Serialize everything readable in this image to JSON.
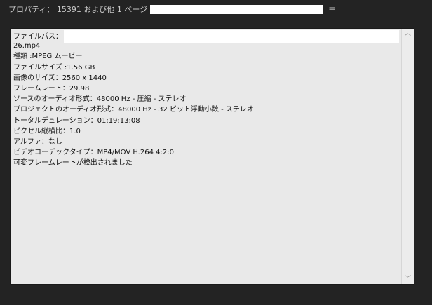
{
  "header": {
    "title": "プロパティ： 15391 および他 1 ページ",
    "menu_icon": "menu-icon",
    "menu_glyph": "≡"
  },
  "properties": {
    "file_path_label": "ファイルパス：",
    "lines": [
      "26.mp4",
      "種類 :MPEG ムービー",
      "ファイルサイズ :1.56 GB",
      "画像のサイズ：2560 x 1440",
      "フレームレート：29.98",
      "ソースのオーディオ形式：48000 Hz - 圧縮 - ステレオ",
      "プロジェクトのオーディオ形式：48000 Hz - 32 ビット浮動小数 - ステレオ",
      "トータルデュレーション：01:19:13:08",
      "ピクセル縦横比：1.0",
      "アルファ：なし",
      "ビデオコーデックタイプ：MP4/MOV H.264 4:2:0",
      "可変フレームレートが検出されました"
    ]
  },
  "scrollbar": {
    "up_glyph": "︿",
    "down_glyph": "﹀"
  }
}
